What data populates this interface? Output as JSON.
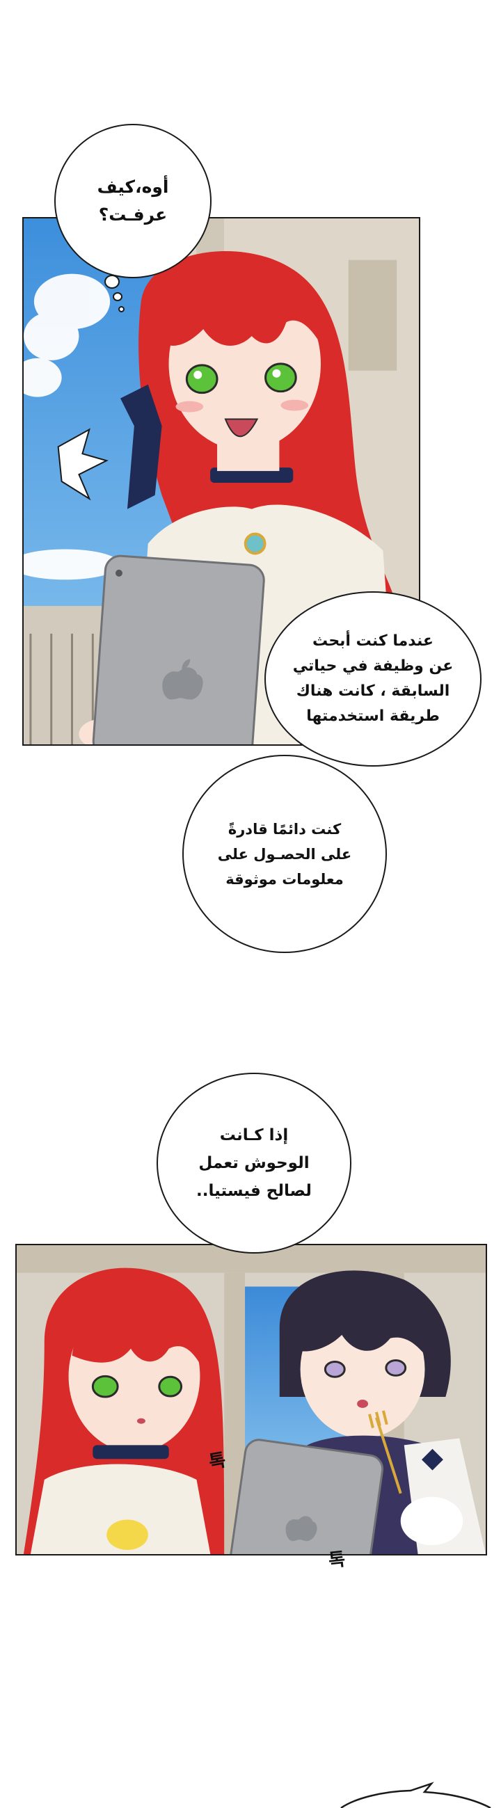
{
  "bubbles": {
    "b1": "أوه،كيف\nعرفـت؟",
    "b2": "عندما كنت أبحث\nعن وظيفة في حياتي\nالسابقة ، كانت هناك\nطريقة استخدمتها",
    "b3": "كنت دائمًا قادرةً\nعلى الحصـول على\nمعلومات موثوقة",
    "b4": "إذا كـانت\nالوحوش تعمل\nلصالح فيستيا.."
  },
  "sfx": {
    "s1": "톡",
    "s2": "톡"
  },
  "colors": {
    "sky": "#4a9be0",
    "hair_red": "#d92b2a",
    "hair_dark": "#2f2a3d",
    "eyes_green": "#5cc23a",
    "ribbon_navy": "#1f2a55",
    "tablet_grey": "#a9abae",
    "stone": "#d8d2c6"
  },
  "icons": {
    "tablet_logo": "apple-logo-icon"
  }
}
